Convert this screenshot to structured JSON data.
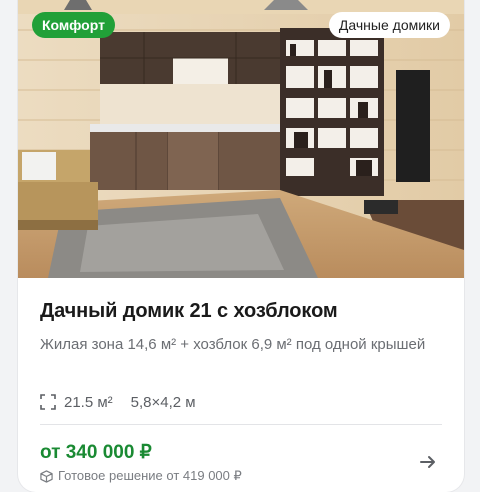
{
  "card": {
    "badge_comfort": "Комфорт",
    "badge_type": "Дачные домики",
    "title": "Дачный домик 21 с хозблоком",
    "description": "Жилая зона 14,6 м² + хозблок 6,9 м² под одной крышей",
    "area": "21.5 м²",
    "dimensions": "5,8×4,2 м",
    "price": "от 340 000 ₽",
    "ready_solution": "Готовое решение от 419 000 ₽"
  },
  "icons": {
    "area": "area-frame-icon",
    "ready": "package-icon",
    "arrow": "arrow-right-icon"
  },
  "colors": {
    "accent_green": "#21a038",
    "price_green": "#1a8a33",
    "text_primary": "#1a1a1a",
    "text_secondary": "#6b6e73"
  }
}
